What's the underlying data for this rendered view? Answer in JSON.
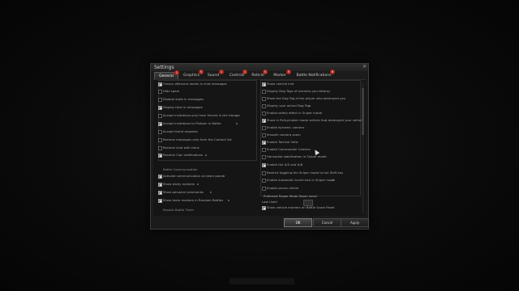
{
  "dialog": {
    "title": "Settings",
    "close_icon": "close-icon"
  },
  "tabs": [
    {
      "label": "General",
      "badge": "1"
    },
    {
      "label": "Graphics",
      "badge": "5"
    },
    {
      "label": "Sound",
      "badge": "1"
    },
    {
      "label": "Controls",
      "badge": "1"
    },
    {
      "label": "Reticle",
      "badge": "5"
    },
    {
      "label": "Marker",
      "badge": "5"
    },
    {
      "label": "Battle Notifications",
      "badge": "6"
    }
  ],
  "left": {
    "items": [
      {
        "label": "Censor offensive words in chat messages",
        "checked": true
      },
      {
        "label": "Hide spam",
        "checked": false
      },
      {
        "label": "Disable state in messages",
        "checked": false
      },
      {
        "label": "Display time in messages",
        "checked": true
      },
      {
        "label": "Accept invitations only from friends in the Garage",
        "checked": false
      },
      {
        "label": "Accept invitations to Platoon in Battle",
        "checked": true
      },
      {
        "label": "Accept friend requests",
        "checked": false
      },
      {
        "label": "Receive messages only from the Contact list",
        "checked": false
      },
      {
        "label": "Receive chat with clans",
        "checked": false
      },
      {
        "label": "Receive Clan notifications",
        "checked": true
      }
    ],
    "section_title": "Battle Communication",
    "section_items": [
      {
        "label": "Activate communication on team panel",
        "checked": true
      },
      {
        "label": "Show sticky markers",
        "checked": true
      },
      {
        "label": "Show personal commands",
        "checked": true
      },
      {
        "label": "Show team markers in Random Battles",
        "checked": true
      }
    ],
    "bottom_label": "Restart Battle Timer"
  },
  "right": {
    "items": [
      {
        "label": "Show vehicle hint",
        "checked": true
      },
      {
        "label": "Display Dog Tags of enemies you destroy",
        "checked": false
      },
      {
        "label": "Show the Dog Tag of the player who destroyed you",
        "checked": false
      },
      {
        "label": "Display your actual Dog Tag",
        "checked": false
      },
      {
        "label": "Enable safety effect in Sniper mode",
        "checked": false
      },
      {
        "label": "Show in Policymaker mode vehicle that destroyed your vehicle",
        "checked": true
      },
      {
        "label": "Enable dynamic camera",
        "checked": false
      },
      {
        "label": "Smooth camera zoom",
        "checked": false
      },
      {
        "label": "Enable Tactical View",
        "checked": true
      },
      {
        "label": "Enable Commander Camera",
        "checked": false
      },
      {
        "label": "Horizontal stabilisation in Sniper mode",
        "checked": false
      },
      {
        "label": "Enable the X/X and X/X",
        "checked": true
      },
      {
        "label": "Restrict toggling the Sniper mode to the Shift key",
        "checked": false
      },
      {
        "label": "Enable automatic turret lock in Sniper mode",
        "checked": false
      },
      {
        "label": "Enable server reticle",
        "checked": false
      }
    ],
    "dropdown_title": "Preferred Sniper Mode Zoom Level",
    "dropdown_value": "Last Used",
    "last_item": {
      "label": "Show vehicle markers on Battle Score Panel",
      "checked": true
    }
  },
  "buttons": {
    "ok": "OK",
    "cancel": "Cancel",
    "apply": "Apply"
  },
  "colors": {
    "badge": "#b3261e",
    "background": "#0b0b0b",
    "panel": "#1b1b1b"
  }
}
